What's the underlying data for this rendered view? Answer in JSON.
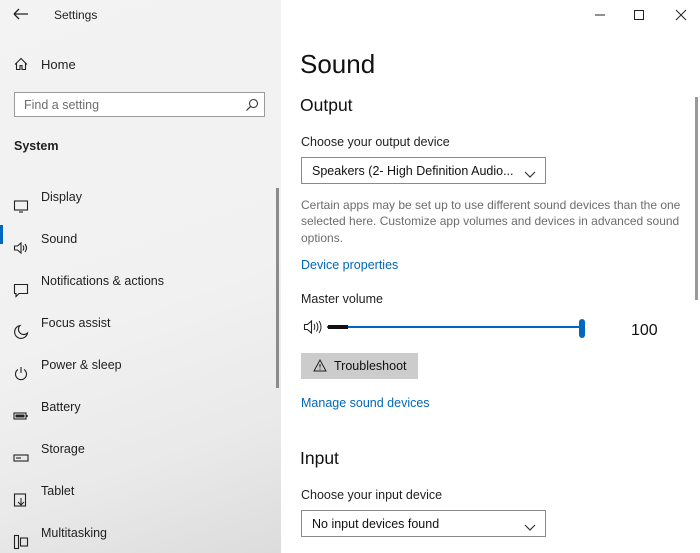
{
  "app": {
    "title": "Settings"
  },
  "sidebar": {
    "home_label": "Home",
    "search_placeholder": "Find a setting",
    "section_title": "System",
    "items": [
      {
        "label": "Display",
        "icon": "display-icon"
      },
      {
        "label": "Sound",
        "icon": "speaker-icon",
        "active": true
      },
      {
        "label": "Notifications & actions",
        "icon": "notifications-icon"
      },
      {
        "label": "Focus assist",
        "icon": "moon-icon"
      },
      {
        "label": "Power & sleep",
        "icon": "power-icon"
      },
      {
        "label": "Battery",
        "icon": "battery-icon"
      },
      {
        "label": "Storage",
        "icon": "storage-icon"
      },
      {
        "label": "Tablet",
        "icon": "tablet-icon"
      },
      {
        "label": "Multitasking",
        "icon": "multitasking-icon"
      }
    ]
  },
  "main": {
    "page_title": "Sound",
    "output": {
      "heading": "Output",
      "device_label": "Choose your output device",
      "device_value": "Speakers (2- High Definition Audio...",
      "description": "Certain apps may be set up to use different sound devices than the one selected here. Customize app volumes and devices in advanced sound options.",
      "device_properties_link": "Device properties",
      "volume_label": "Master volume",
      "volume_value": "100",
      "volume_level": 100,
      "troubleshoot_label": "Troubleshoot",
      "manage_link": "Manage sound devices"
    },
    "input": {
      "heading": "Input",
      "device_label": "Choose your input device",
      "device_value": "No input devices found"
    }
  },
  "colors": {
    "accent": "#0067c0",
    "link": "#0067b8",
    "sidebar_bg": "#f2f2f2",
    "button_bg": "#cccccc"
  }
}
